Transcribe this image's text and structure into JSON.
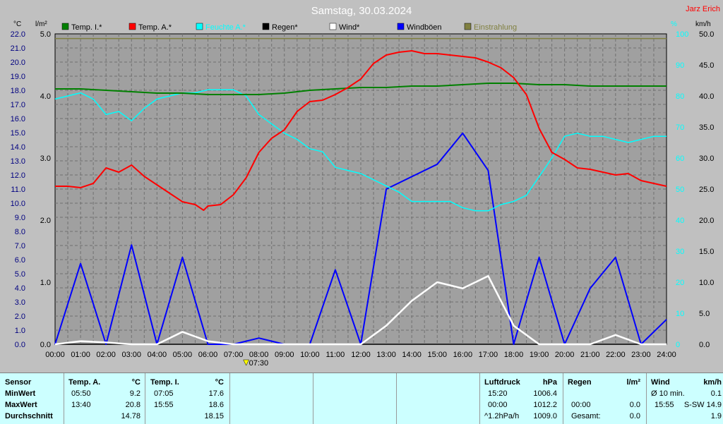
{
  "title": "Samstag, 30.03.2024",
  "station": "Jarz Erich",
  "marker_label": "07:30",
  "colors": {
    "temp_i": "#008000",
    "temp_a": "#ff0000",
    "feuchte": "#00ffff",
    "regen": "#000000",
    "wind": "#ffffff",
    "windboeen": "#0000ff",
    "einstrahlung": "#808040"
  },
  "chart_data": {
    "type": "line",
    "title": "Samstag, 30.03.2024",
    "x_ticks": [
      "00:00",
      "01:00",
      "02:00",
      "03:00",
      "04:00",
      "05:00",
      "06:00",
      "07:00",
      "08:00",
      "09:00",
      "10:00",
      "11:00",
      "12:00",
      "13:00",
      "14:00",
      "15:00",
      "16:00",
      "17:00",
      "18:00",
      "19:00",
      "20:00",
      "21:00",
      "22:00",
      "23:00",
      "24:00"
    ],
    "axes": {
      "temp": {
        "unit": "°C",
        "range": [
          0,
          22
        ],
        "ticks": [
          "0.0",
          "1.0",
          "2.0",
          "3.0",
          "4.0",
          "5.0",
          "6.0",
          "7.0",
          "8.0",
          "9.0",
          "10.0",
          "11.0",
          "12.0",
          "13.0",
          "14.0",
          "15.0",
          "16.0",
          "17.0",
          "18.0",
          "19.0",
          "20.0",
          "21.0",
          "22.0"
        ]
      },
      "rain": {
        "unit": "l/m²",
        "range": [
          0,
          5
        ],
        "ticks": [
          "0.0",
          "1.0",
          "2.0",
          "3.0",
          "4.0",
          "5.0"
        ]
      },
      "humidity": {
        "unit": "%",
        "range": [
          0,
          100
        ],
        "ticks": [
          "0",
          "10",
          "20",
          "30",
          "40",
          "50",
          "60",
          "70",
          "80",
          "90",
          "100"
        ]
      },
      "wind": {
        "unit": "km/h",
        "range": [
          0,
          50
        ],
        "ticks": [
          "0.0",
          "5.0",
          "10.0",
          "15.0",
          "20.0",
          "25.0",
          "30.0",
          "35.0",
          "40.0",
          "45.0",
          "50.0"
        ]
      }
    },
    "legend": [
      "Temp. I.*",
      "Temp. A.*",
      "Feuchte A.*",
      "Regen*",
      "Wind*",
      "Windböen",
      "Einstrahlung"
    ],
    "series": [
      {
        "name": "Temp. I.*",
        "axis": "temp",
        "x": [
          0,
          1,
          2,
          3,
          4,
          5,
          6,
          7,
          8,
          9,
          10,
          11,
          12,
          13,
          14,
          15,
          16,
          17,
          18,
          19,
          20,
          21,
          22,
          23,
          24
        ],
        "y": [
          18.1,
          18.1,
          18.0,
          17.9,
          17.8,
          17.8,
          17.7,
          17.7,
          17.7,
          17.8,
          18.0,
          18.1,
          18.2,
          18.2,
          18.3,
          18.3,
          18.4,
          18.5,
          18.5,
          18.4,
          18.4,
          18.3,
          18.3,
          18.3,
          18.3
        ]
      },
      {
        "name": "Temp. A.*",
        "axis": "temp",
        "x": [
          0,
          0.5,
          1,
          1.5,
          2,
          2.5,
          3,
          3.5,
          4,
          4.5,
          5,
          5.5,
          5.83,
          6,
          6.5,
          7,
          7.5,
          8,
          8.5,
          9,
          9.5,
          10,
          10.5,
          11,
          11.5,
          12,
          12.5,
          13,
          13.5,
          14,
          14.5,
          15,
          15.5,
          16,
          16.5,
          17,
          17.5,
          18,
          18.5,
          19,
          19.5,
          20,
          20.5,
          21,
          21.5,
          22,
          22.5,
          23,
          23.5,
          24
        ],
        "y": [
          11.2,
          11.2,
          11.1,
          11.4,
          12.5,
          12.2,
          12.7,
          11.9,
          11.3,
          10.7,
          10.1,
          9.9,
          9.5,
          9.8,
          9.9,
          10.6,
          11.8,
          13.6,
          14.6,
          15.2,
          16.5,
          17.2,
          17.3,
          17.7,
          18.2,
          18.8,
          19.9,
          20.5,
          20.7,
          20.8,
          20.6,
          20.6,
          20.5,
          20.4,
          20.3,
          20.0,
          19.6,
          18.9,
          17.7,
          15.3,
          13.6,
          13.1,
          12.5,
          12.4,
          12.2,
          12.0,
          12.1,
          11.6,
          11.4,
          11.2
        ]
      },
      {
        "name": "Feuchte A.*",
        "axis": "humidity",
        "x": [
          0,
          0.5,
          1,
          1.5,
          2,
          2.5,
          3,
          3.5,
          4,
          4.5,
          5,
          5.5,
          6,
          6.5,
          7,
          7.5,
          8,
          8.5,
          9,
          9.5,
          10,
          10.5,
          11,
          11.5,
          12,
          12.5,
          13,
          13.5,
          14,
          14.5,
          15,
          15.5,
          16,
          16.5,
          17,
          17.5,
          18,
          18.5,
          19,
          19.5,
          20,
          20.5,
          21,
          21.5,
          22,
          22.5,
          23,
          23.5,
          24
        ],
        "y": [
          79,
          80,
          81,
          79,
          74,
          75,
          72,
          76,
          79,
          80,
          81,
          81,
          82,
          82,
          82,
          80,
          74,
          71,
          68,
          66,
          63,
          62,
          57,
          56,
          55,
          53,
          51,
          49,
          46,
          46,
          46,
          46,
          44,
          43,
          43,
          45,
          46,
          48,
          54,
          60,
          67,
          68,
          67,
          67,
          66,
          65,
          66,
          67,
          67
        ]
      },
      {
        "name": "Windböen",
        "axis": "wind",
        "x": [
          0,
          1,
          2,
          3,
          4,
          5,
          6,
          7,
          8,
          9,
          10,
          11,
          12,
          13,
          14,
          15,
          16,
          17,
          18,
          19,
          20,
          21,
          22,
          23,
          24
        ],
        "y": [
          0,
          13,
          0,
          16,
          0,
          14,
          0,
          0,
          1,
          0,
          0,
          12,
          0,
          25,
          27,
          29,
          34,
          28,
          0,
          14,
          0,
          9,
          14,
          0,
          4
        ]
      },
      {
        "name": "Wind*",
        "axis": "wind",
        "x": [
          0,
          1,
          2,
          3,
          4,
          5,
          6,
          7,
          8,
          9,
          10,
          11,
          12,
          13,
          14,
          15,
          16,
          17,
          18,
          19,
          20,
          21,
          22,
          23,
          24
        ],
        "y": [
          0,
          0.5,
          0.3,
          0,
          0,
          2,
          0.5,
          0,
          0,
          0,
          0,
          0,
          0,
          3,
          7,
          10,
          9,
          11,
          3,
          0,
          0,
          0,
          1.5,
          0,
          0
        ]
      },
      {
        "name": "Einstrahlung",
        "axis": "humidity",
        "x": [
          0,
          4,
          8,
          12,
          16,
          20,
          24
        ],
        "y": [
          98.5,
          98.5,
          98.5,
          98.5,
          98.5,
          98.5,
          98.5
        ]
      },
      {
        "name": "Regen*",
        "axis": "rain",
        "x": [
          0,
          24
        ],
        "y": [
          0,
          0
        ]
      }
    ]
  },
  "table": {
    "row_labels": [
      "Sensor",
      "MinWert",
      "MaxWert",
      "Durchschnitt"
    ],
    "temp_a": {
      "header": "Temp. A.",
      "unit": "°C",
      "min_time": "05:50",
      "min": "9.2",
      "max_time": "13:40",
      "max": "20.8",
      "avg": "14.78"
    },
    "temp_i": {
      "header": "Temp. I.",
      "unit": "°C",
      "min_time": "07:05",
      "min": "17.6",
      "max_time": "15:55",
      "max": "18.6",
      "avg": "18.15"
    },
    "luftdruck": {
      "header": "Luftdruck",
      "unit": "hPa",
      "r1_time": "15:20",
      "r1": "1006.4",
      "r2_time": "00:00",
      "r2": "1012.2",
      "r3_label": "^1.2hPa/h",
      "r3": "1009.0"
    },
    "regen": {
      "header": "Regen",
      "unit": "l/m²",
      "r2_time": "00:00",
      "r2": "0.0",
      "r3_label": "Gesamt:",
      "r3": "0.0"
    },
    "wind": {
      "header": "Wind",
      "unit": "km/h",
      "r1_label": "Ø 10 min.",
      "r1": "0.1",
      "r2_time": "15:55",
      "r2": "S-SW 14.9",
      "r3": "1.9"
    }
  }
}
